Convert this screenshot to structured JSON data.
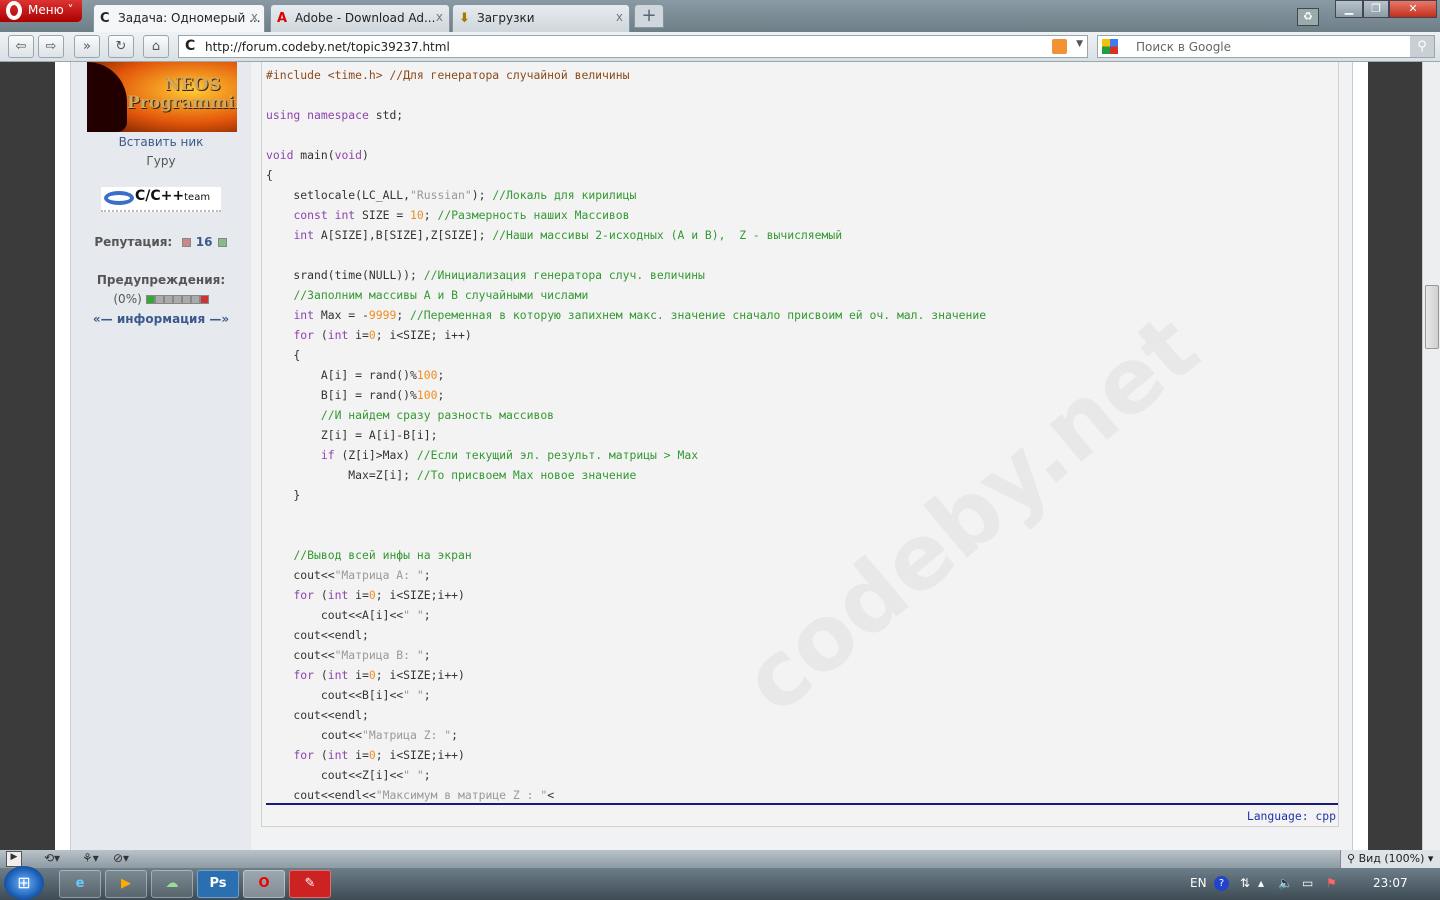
{
  "browser": {
    "menu_label": "Меню",
    "tabs": [
      {
        "label": "Задача: Одномерый ...",
        "icon": "C"
      },
      {
        "label": "Adobe - Download Ad...",
        "icon": "A"
      },
      {
        "label": "Загрузки",
        "icon": "⬇"
      }
    ],
    "close_tab": "x",
    "new_tab": "+",
    "url": "http://forum.codeby.net/topic39237.html",
    "search_placeholder": "Поиск в Google"
  },
  "sidebar": {
    "avatar_text": "NEOS Programming",
    "nick": "Вставить ник",
    "rank": "Гуру",
    "team_badge": "C/C++",
    "team_sub": "team",
    "reputation_label": "Репутация:",
    "reputation_value": "16",
    "warnings_label": "Предупреждения:",
    "warnings_percent": "(0%)",
    "info_link": "«— информация —»"
  },
  "code": {
    "watermark": "codeby.net",
    "language": "Language: cpp",
    "lines": [
      [
        [
          "#include <time.h> //Для генератора случайной величины",
          "pp"
        ]
      ],
      [],
      [
        [
          "using namespace",
          "kw"
        ],
        [
          " std;",
          ""
        ]
      ],
      [],
      [
        [
          "void",
          "kw"
        ],
        [
          " main(",
          ""
        ],
        [
          "void",
          "kw"
        ],
        [
          ")",
          ""
        ]
      ],
      [
        [
          "{",
          ""
        ]
      ],
      [
        [
          "    setlocale(LC_ALL,",
          ""
        ],
        [
          "\"Russian\"",
          "st"
        ],
        [
          "); ",
          ""
        ],
        [
          "//Локаль для кирилицы",
          "cm"
        ]
      ],
      [
        [
          "    ",
          ""
        ],
        [
          "const int",
          "kw"
        ],
        [
          " SIZE = ",
          ""
        ],
        [
          "10",
          "nu"
        ],
        [
          "; ",
          ""
        ],
        [
          "//Размерность наших Массивов",
          "cm"
        ]
      ],
      [
        [
          "    ",
          ""
        ],
        [
          "int",
          "kw"
        ],
        [
          " A[SIZE],B[SIZE],Z[SIZE]; ",
          ""
        ],
        [
          "//Наши массивы 2-исходных (A и B),  Z - вычисляемый",
          "cm"
        ]
      ],
      [],
      [
        [
          "    srand(time(NULL)); ",
          ""
        ],
        [
          "//Инициализация генератора случ. величины",
          "cm"
        ]
      ],
      [
        [
          "    ",
          ""
        ],
        [
          "//Заполним массивы A и B случайными числами",
          "cm"
        ]
      ],
      [
        [
          "    ",
          ""
        ],
        [
          "int",
          "kw"
        ],
        [
          " Max = -",
          ""
        ],
        [
          "9999",
          "nu"
        ],
        [
          "; ",
          ""
        ],
        [
          "//Переменная в которую запихнем макс. значение сначало присвоим ей оч. мал. значение",
          "cm"
        ]
      ],
      [
        [
          "    ",
          ""
        ],
        [
          "for",
          "kw"
        ],
        [
          " (",
          ""
        ],
        [
          "int",
          "kw"
        ],
        [
          " i=",
          ""
        ],
        [
          "0",
          "nu"
        ],
        [
          "; i<SIZE; i++)",
          ""
        ]
      ],
      [
        [
          "    {",
          ""
        ]
      ],
      [
        [
          "        A[i] = rand()%",
          ""
        ],
        [
          "100",
          "nu"
        ],
        [
          ";",
          ""
        ]
      ],
      [
        [
          "        B[i] = rand()%",
          ""
        ],
        [
          "100",
          "nu"
        ],
        [
          ";",
          ""
        ]
      ],
      [
        [
          "        ",
          ""
        ],
        [
          "//И найдем сразу разность массивов",
          "cm"
        ]
      ],
      [
        [
          "        Z[i] = A[i]-B[i];",
          ""
        ]
      ],
      [
        [
          "        ",
          ""
        ],
        [
          "if",
          "kw"
        ],
        [
          " (Z[i]>Max) ",
          ""
        ],
        [
          "//Если текущий эл. результ. матрицы > Max",
          "cm"
        ]
      ],
      [
        [
          "            Max=Z[i]; ",
          ""
        ],
        [
          "//То присвоем Max новое значение",
          "cm"
        ]
      ],
      [
        [
          "    }",
          ""
        ]
      ],
      [],
      [],
      [
        [
          "    ",
          ""
        ],
        [
          "//Вывод всей инфы на экран",
          "cm"
        ]
      ],
      [
        [
          "    cout<<",
          ""
        ],
        [
          "\"Матрица A: \"",
          "st"
        ],
        [
          ";",
          ""
        ]
      ],
      [
        [
          "    ",
          ""
        ],
        [
          "for",
          "kw"
        ],
        [
          " (",
          ""
        ],
        [
          "int",
          "kw"
        ],
        [
          " i=",
          ""
        ],
        [
          "0",
          "nu"
        ],
        [
          "; i<SIZE;i++)",
          ""
        ]
      ],
      [
        [
          "        cout<<A[i]<<",
          ""
        ],
        [
          "\" \"",
          "st"
        ],
        [
          ";",
          ""
        ]
      ],
      [
        [
          "    cout<<endl;",
          ""
        ]
      ],
      [
        [
          "    cout<<",
          ""
        ],
        [
          "\"Матрица B: \"",
          "st"
        ],
        [
          ";",
          ""
        ]
      ],
      [
        [
          "    ",
          ""
        ],
        [
          "for",
          "kw"
        ],
        [
          " (",
          ""
        ],
        [
          "int",
          "kw"
        ],
        [
          " i=",
          ""
        ],
        [
          "0",
          "nu"
        ],
        [
          "; i<SIZE;i++)",
          ""
        ]
      ],
      [
        [
          "        cout<<B[i]<<",
          ""
        ],
        [
          "\" \"",
          "st"
        ],
        [
          ";",
          ""
        ]
      ],
      [
        [
          "    cout<<endl;",
          ""
        ]
      ],
      [
        [
          "        cout<<",
          ""
        ],
        [
          "\"Матрица Z: \"",
          "st"
        ],
        [
          ";",
          ""
        ]
      ],
      [
        [
          "    ",
          ""
        ],
        [
          "for",
          "kw"
        ],
        [
          " (",
          ""
        ],
        [
          "int",
          "kw"
        ],
        [
          " i=",
          ""
        ],
        [
          "0",
          "nu"
        ],
        [
          "; i<SIZE;i++)",
          ""
        ]
      ],
      [
        [
          "        cout<<Z[i]<<",
          ""
        ],
        [
          "\" \"",
          "st"
        ],
        [
          ";",
          ""
        ]
      ],
      [
        [
          "    cout<<endl<<",
          ""
        ],
        [
          "\"Максимум в матрице Z : \"",
          "st"
        ],
        [
          "<",
          ""
        ]
      ]
    ]
  },
  "statusbar": {
    "zoom_label": "Вид (100%)"
  },
  "taskbar": {
    "lang": "EN",
    "clock": "23:07",
    "apps": [
      "e",
      "▶",
      "☁",
      "Ps",
      "O",
      "✎"
    ]
  }
}
